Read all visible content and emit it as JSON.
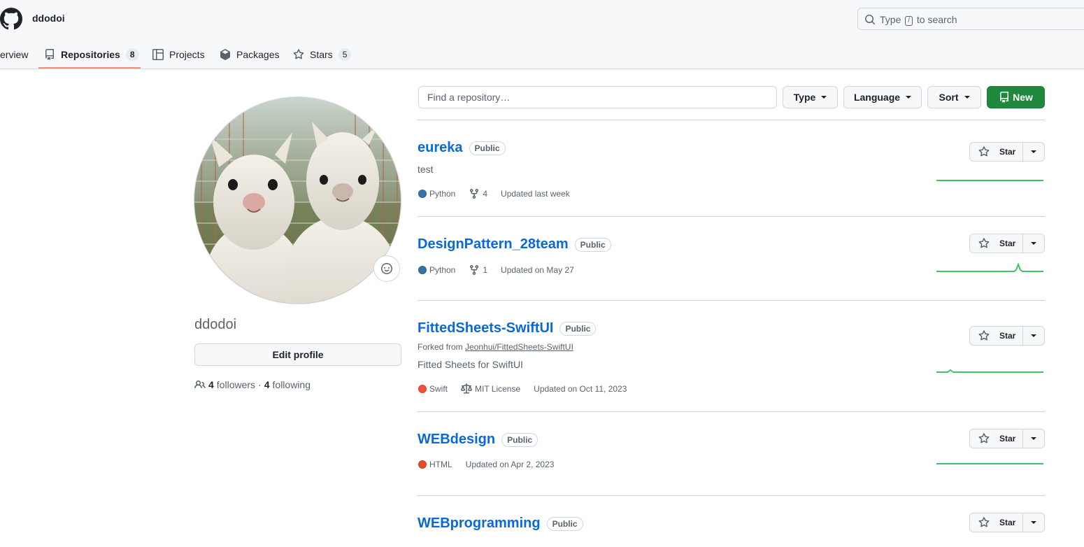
{
  "header": {
    "username": "ddodoi",
    "search_prefix": "Type",
    "search_key": "/",
    "search_suffix": "to search"
  },
  "tabs": [
    {
      "label": "erview"
    },
    {
      "label": "Repositories",
      "count": "8"
    },
    {
      "label": "Projects"
    },
    {
      "label": "Packages"
    },
    {
      "label": "Stars",
      "count": "5"
    }
  ],
  "profile": {
    "name": "ddodoi",
    "edit_label": "Edit profile",
    "followers_count": "4",
    "followers_label": "followers",
    "separator": "·",
    "following_count": "4",
    "following_label": "following"
  },
  "filters": {
    "find_placeholder": "Find a repository…",
    "type_label": "Type",
    "language_label": "Language",
    "sort_label": "Sort",
    "new_label": "New"
  },
  "star_label": "Star",
  "repos": [
    {
      "name": "eureka",
      "visibility": "Public",
      "description": "test",
      "language": "Python",
      "lang_color": "#3572A5",
      "forks": "4",
      "updated": "Updated last week"
    },
    {
      "name": "DesignPattern_28team",
      "visibility": "Public",
      "language": "Python",
      "lang_color": "#3572A5",
      "forks": "1",
      "updated": "Updated on May 27"
    },
    {
      "name": "FittedSheets-SwiftUI",
      "visibility": "Public",
      "forked_prefix": "Forked from",
      "forked_from": "Jeonhui/FittedSheets-SwiftUI",
      "description": "Fitted Sheets for SwiftUI",
      "language": "Swift",
      "lang_color": "#F05138",
      "license": "MIT License",
      "updated": "Updated on Oct 11, 2023"
    },
    {
      "name": "WEBdesign",
      "visibility": "Public",
      "language": "HTML",
      "lang_color": "#e34c26",
      "updated": "Updated on Apr 2, 2023"
    },
    {
      "name": "WEBprogramming",
      "visibility": "Public"
    }
  ],
  "colors": {
    "accent": "#0969da",
    "new_button": "#1f883d",
    "tab_underline": "#fd8c73",
    "sparkline": "#40c463"
  }
}
